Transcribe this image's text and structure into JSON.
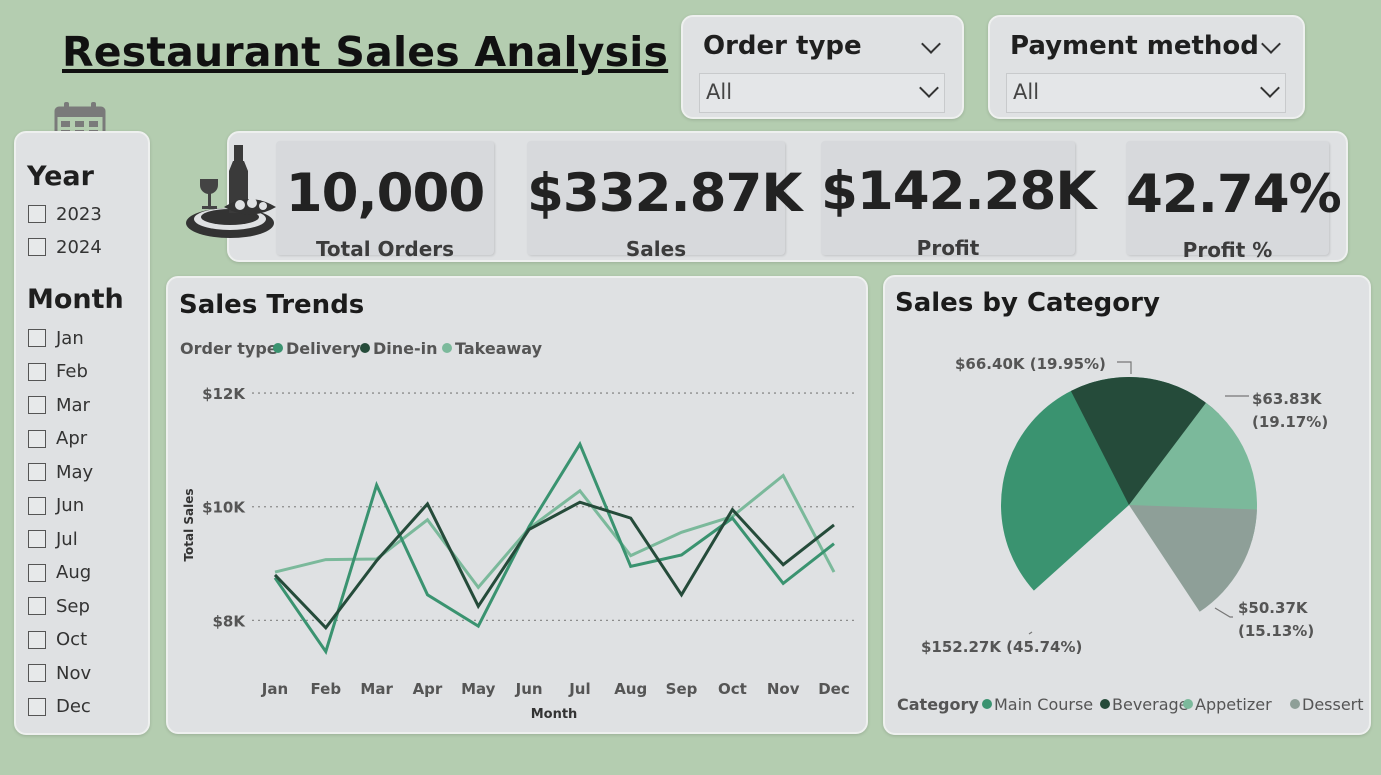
{
  "title": "Restaurant Sales Analysis",
  "filters": {
    "order_type": {
      "label": "Order type",
      "value": "All"
    },
    "payment_method": {
      "label": "Payment method",
      "value": "All"
    }
  },
  "side_filter": {
    "year_heading": "Year",
    "years": [
      "2023",
      "2024"
    ],
    "month_heading": "Month",
    "months": [
      "Jan",
      "Feb",
      "Mar",
      "Apr",
      "May",
      "Jun",
      "Jul",
      "Aug",
      "Sep",
      "Oct",
      "Nov",
      "Dec"
    ]
  },
  "kpis": [
    {
      "value": "10,000",
      "label": "Total Orders"
    },
    {
      "value": "$332.87K",
      "label": "Sales"
    },
    {
      "value": "$142.28K",
      "label": "Profit"
    },
    {
      "value": "42.74%",
      "label": "Profit %"
    }
  ],
  "icons": [
    "calendar-icon",
    "restaurant-icon"
  ],
  "colors": {
    "background": "#b4cdb0",
    "delivery": "#3a9370",
    "dine_in": "#254b3a",
    "takeaway": "#7bb99b",
    "dessert": "#8e9f98"
  },
  "chart_data": [
    {
      "type": "line",
      "title": "Sales Trends",
      "legend_title": "Order type",
      "xlabel": "Month",
      "ylabel": "Total Sales",
      "categories": [
        "Jan",
        "Feb",
        "Mar",
        "Apr",
        "May",
        "Jun",
        "Jul",
        "Aug",
        "Sep",
        "Oct",
        "Nov",
        "Dec"
      ],
      "yticks": [
        {
          "value": 8000,
          "label": "$8K"
        },
        {
          "value": 10000,
          "label": "$10K"
        },
        {
          "value": 12000,
          "label": "$12K"
        }
      ],
      "ylim": [
        7250,
        12300
      ],
      "grid": true,
      "legend_position": "top-left",
      "series": [
        {
          "name": "Delivery",
          "color": "#3a9370",
          "values": [
            8750,
            7450,
            10380,
            8450,
            7900,
            9650,
            11100,
            8950,
            9150,
            9800,
            8650,
            9350
          ]
        },
        {
          "name": "Dine-in",
          "color": "#254b3a",
          "values": [
            8800,
            7870,
            9050,
            10050,
            8250,
            9600,
            10080,
            9800,
            8450,
            9950,
            8980,
            9680
          ]
        },
        {
          "name": "Takeaway",
          "color": "#7bb99b",
          "values": [
            8850,
            9070,
            9080,
            9770,
            8580,
            9620,
            10280,
            9140,
            9550,
            9830,
            10550,
            8850
          ]
        }
      ]
    },
    {
      "type": "pie",
      "title": "Sales by Category",
      "legend_title": "Category",
      "legend_position": "bottom",
      "slices": [
        {
          "name": "Main Course",
          "value": 152.27,
          "percent": 45.74,
          "label": "$152.27K (45.74%)",
          "color": "#3a9370"
        },
        {
          "name": "Beverage",
          "value": 66.4,
          "percent": 19.95,
          "label": "$66.40K (19.95%)",
          "color": "#254b3a"
        },
        {
          "name": "Appetizer",
          "value": 63.83,
          "percent": 19.17,
          "label": "$63.83K (19.17%)",
          "color": "#7bb99b"
        },
        {
          "name": "Dessert",
          "value": 50.37,
          "percent": 15.13,
          "label": "$50.37K (15.13%)",
          "color": "#8e9f98"
        }
      ]
    }
  ]
}
